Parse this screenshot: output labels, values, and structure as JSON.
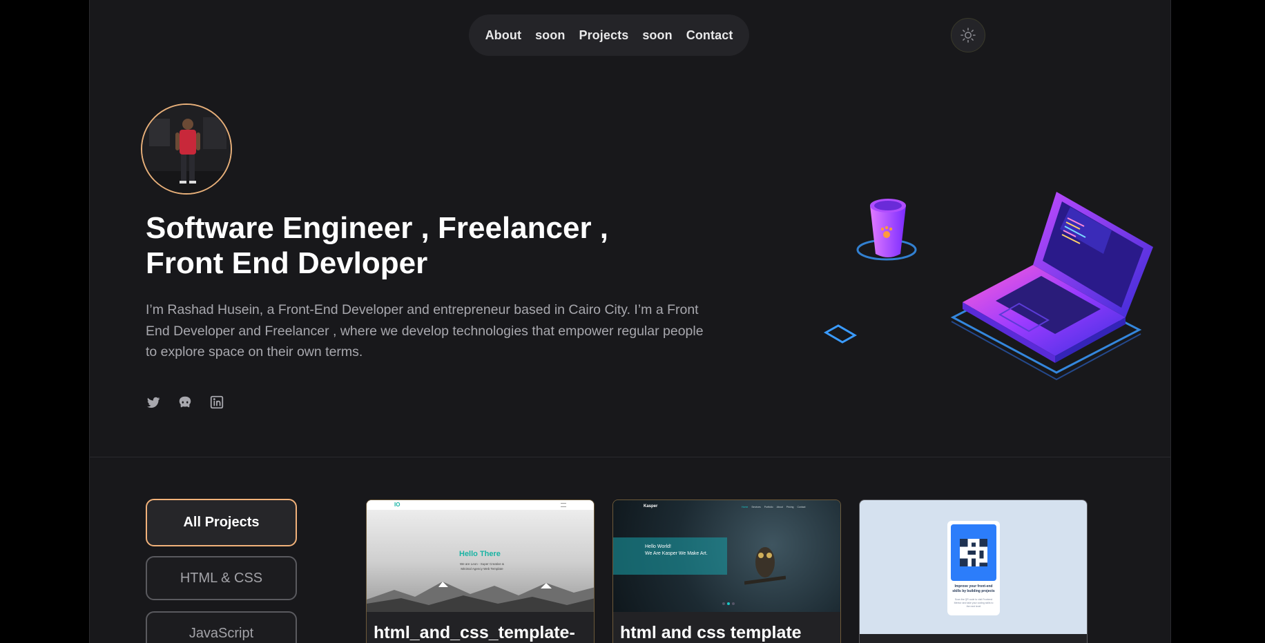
{
  "nav": {
    "items": [
      {
        "label": "About"
      },
      {
        "label": "soon"
      },
      {
        "label": "Projects"
      },
      {
        "label": "soon"
      },
      {
        "label": "Contact"
      }
    ]
  },
  "theme_toggle": {
    "icon": "sun-icon"
  },
  "hero": {
    "title_line1": "Software Engineer , Freelancer ,",
    "title_line2": "Front End Devloper",
    "description": "I’m Rashad Husein, a Front-End Developer and entrepreneur based in Cairo City. I’m a Front End Developer and Freelancer , where we develop technologies that empower regular people to explore space on their own terms."
  },
  "socials": [
    {
      "icon": "twitter-icon"
    },
    {
      "icon": "github-icon"
    },
    {
      "icon": "linkedin-icon"
    }
  ],
  "filters": [
    {
      "label": "All Projects",
      "active": true
    },
    {
      "label": "HTML & CSS",
      "active": false
    },
    {
      "label": "JavaScript",
      "active": false
    }
  ],
  "cards": [
    {
      "title": "html_and_css_template-",
      "thumb": {
        "logo": "IO",
        "heading": "Hello There",
        "sub": "We are Leon - Super Creative & Minimal Agency Web Template"
      }
    },
    {
      "title": "html and css template",
      "thumb": {
        "logo": "Kasper",
        "nav": [
          "Home",
          "Services",
          "Portfolio",
          "About",
          "Pricing",
          "Contact"
        ],
        "heading1": "Hello World!",
        "heading2": "We Are Kasper We Make Art."
      }
    },
    {
      "title": "",
      "thumb": {
        "heading": "Improve your front-end skills by building projects",
        "sub": "Scan the QR code to visit Frontend Mentor and take your coding skills to the next level"
      }
    }
  ],
  "colors": {
    "accent": "#f2b27a",
    "background": "#18181b",
    "surface": "#242428"
  }
}
